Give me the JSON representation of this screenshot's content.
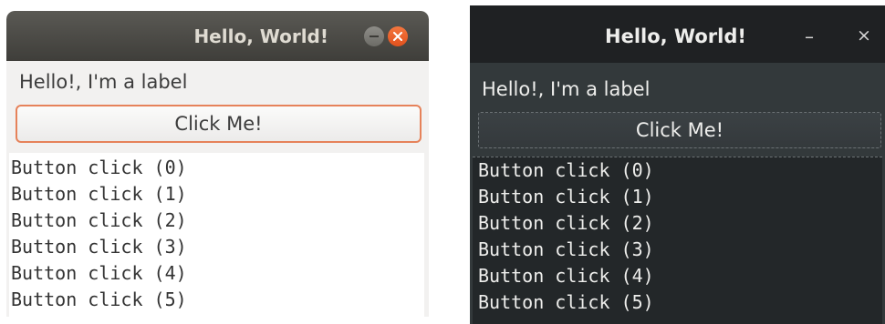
{
  "window_light": {
    "title": "Hello, World!",
    "label": "Hello!, I'm a label",
    "button_label": "Click Me!",
    "output_lines": [
      "Button click (0)",
      "Button click (1)",
      "Button click (2)",
      "Button click (3)",
      "Button click (4)",
      "Button click (5)"
    ],
    "controls": {
      "minimize_icon": "minimize-icon",
      "close_icon": "close-icon"
    },
    "colors": {
      "titlebar": "#4b4a46",
      "close": "#e95420",
      "button_border": "#e6825a"
    }
  },
  "window_dark": {
    "title": "Hello, World!",
    "label": "Hello!, I'm a label",
    "button_label": "Click Me!",
    "output_lines": [
      "Button click (0)",
      "Button click (1)",
      "Button click (2)",
      "Button click (3)",
      "Button click (4)",
      "Button click (5)"
    ],
    "controls": {
      "minimize_glyph": "–",
      "close_glyph": "×"
    },
    "colors": {
      "titlebar": "#1f2123",
      "body": "#33393b",
      "textarea": "#232729"
    }
  }
}
